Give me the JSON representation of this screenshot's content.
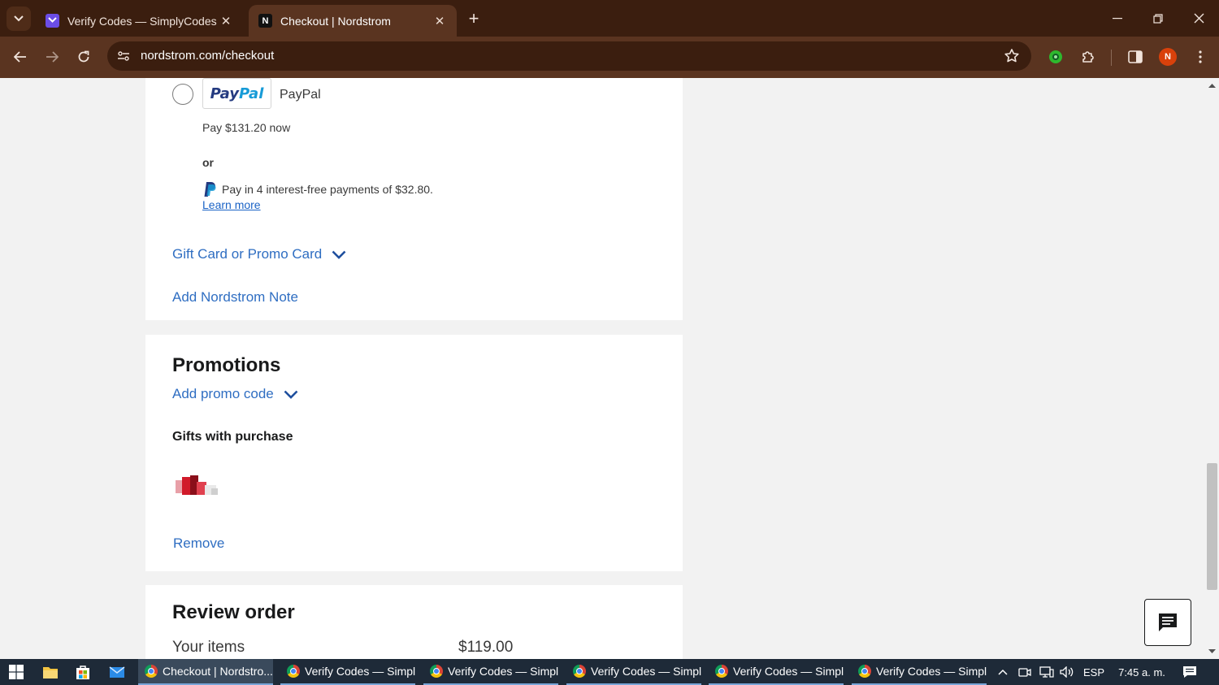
{
  "browser": {
    "tabs": [
      {
        "title": "Verify Codes — SimplyCodes",
        "favicon": "simplycodes-icon",
        "active": false
      },
      {
        "title": "Checkout | Nordstrom",
        "favicon": "nordstrom-icon",
        "favicon_letter": "N",
        "active": true
      }
    ],
    "url": "nordstrom.com/checkout",
    "profile_initial": "N",
    "theme_color": "#5a3420"
  },
  "payment": {
    "paypal_logo_1": "Pay",
    "paypal_logo_2": "Pal",
    "paypal_label": "PayPal",
    "pay_now": "Pay $131.20 now",
    "or": "or",
    "pay_in_4": "Pay in 4 interest-free payments of $32.80.",
    "learn_more": "Learn more",
    "gift_card": "Gift Card or Promo Card",
    "add_note": "Add Nordstrom Note"
  },
  "promotions": {
    "title": "Promotions",
    "add_promo": "Add promo code",
    "gifts_title": "Gifts with purchase",
    "remove": "Remove"
  },
  "review": {
    "title": "Review order",
    "items_label": "Your items",
    "items_value": "$119.00"
  },
  "taskbar": {
    "apps": [
      {
        "label": "Checkout | Nordstro...",
        "active": true
      },
      {
        "label": "Verify Codes — Simpl...",
        "active": false
      },
      {
        "label": "Verify Codes — Simpl...",
        "active": false
      },
      {
        "label": "Verify Codes — Simpl...",
        "active": false
      },
      {
        "label": "Verify Codes — Simpl...",
        "active": false
      },
      {
        "label": "Verify Codes — Simpl...",
        "active": false
      }
    ],
    "language": "ESP",
    "time": "7:45 a. m."
  },
  "colors": {
    "link_blue": "#2f6ec2",
    "tabbar": "#3b1e0f",
    "taskbar": "#1e2a38"
  }
}
